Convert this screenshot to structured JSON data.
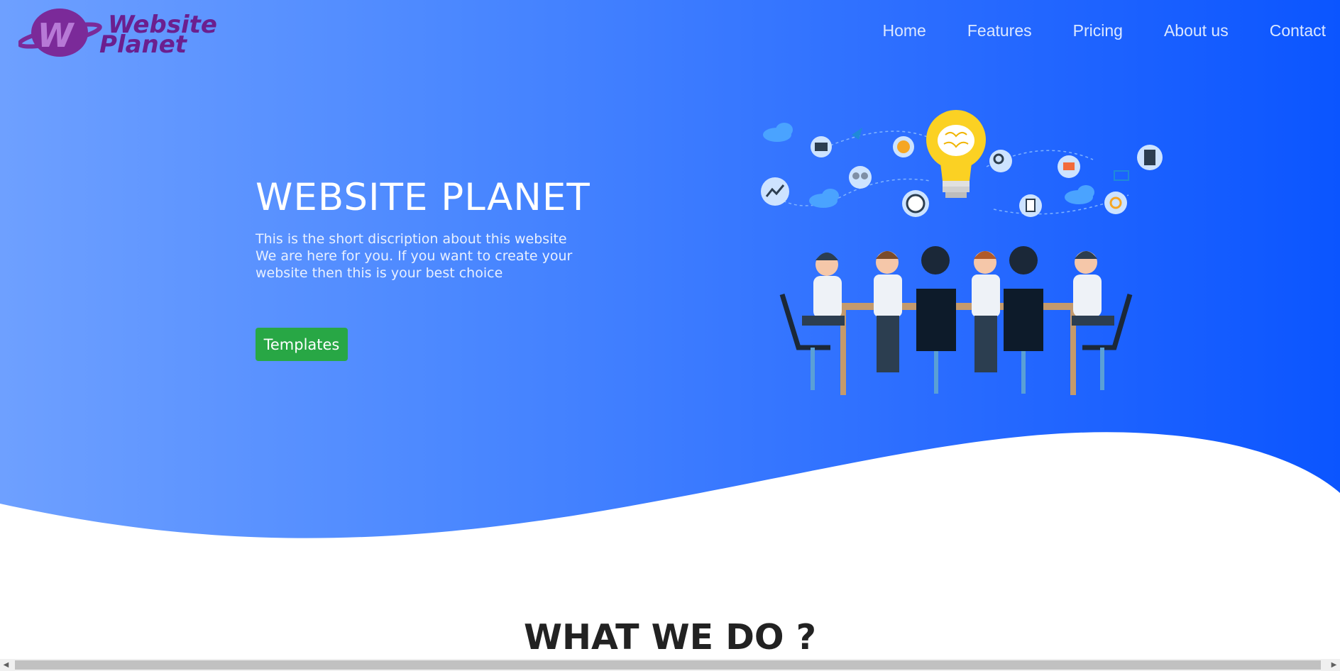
{
  "brand": {
    "line1": "Website",
    "line2": "Planet"
  },
  "nav": [
    {
      "label": "Home"
    },
    {
      "label": "Features"
    },
    {
      "label": "Pricing"
    },
    {
      "label": "About us"
    },
    {
      "label": "Contact"
    }
  ],
  "hero": {
    "title": "WEBSITE PLANET",
    "description": "This is the short discription about this website We are here for you. If you want to create your website then this is your best choice",
    "button_label": "Templates"
  },
  "section": {
    "title": "WHAT WE DO ?"
  },
  "colors": {
    "accent": "#28a745",
    "brand": "#7b2a99",
    "hero_start": "#6ea0ff",
    "hero_end": "#0b55ff"
  }
}
